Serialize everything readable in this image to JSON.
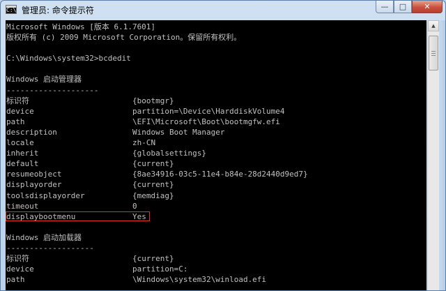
{
  "window": {
    "title": "管理员: 命令提示符",
    "icon_label": "C:\\",
    "controls": {
      "minimize": "—",
      "maximize": "□",
      "close": "✕"
    }
  },
  "console": {
    "lines": [
      {
        "text": "Microsoft Windows [版本 6.1.7601]"
      },
      {
        "text": "版权所有 (c) 2009 Microsoft Corporation。保留所有权利。"
      },
      {
        "text": ""
      },
      {
        "text": "C:\\Windows\\system32>bcdedit"
      },
      {
        "text": ""
      },
      {
        "text": "Windows 启动管理器"
      },
      {
        "text": "--------------------"
      },
      {
        "key": "标识符",
        "value": "{bootmgr}"
      },
      {
        "key": "device",
        "value": "partition=\\Device\\HarddiskVolume4"
      },
      {
        "key": "path",
        "value": "\\EFI\\Microsoft\\Boot\\bootmgfw.efi"
      },
      {
        "key": "description",
        "value": "Windows Boot Manager"
      },
      {
        "key": "locale",
        "value": "zh-CN"
      },
      {
        "key": "inherit",
        "value": "{globalsettings}"
      },
      {
        "key": "default",
        "value": "{current}"
      },
      {
        "key": "resumeobject",
        "value": "{8ae34916-03c5-11e4-b84e-28d2440d9ed7}"
      },
      {
        "key": "displayorder",
        "value": "{current}"
      },
      {
        "key": "toolsdisplayorder",
        "value": "{memdiag}"
      },
      {
        "key": "timeout",
        "value": "0"
      },
      {
        "key": "displaybootmenu",
        "value": "Yes",
        "highlight": true
      },
      {
        "text": ""
      },
      {
        "text": "Windows 启动加载器"
      },
      {
        "text": "-------------------"
      },
      {
        "key": "标识符",
        "value": "{current}"
      },
      {
        "key": "device",
        "value": "partition=C:"
      },
      {
        "key": "path",
        "value": "\\Windows\\system32\\winload.efi"
      }
    ]
  },
  "scrollbar": {
    "up_arrow": "▲"
  }
}
